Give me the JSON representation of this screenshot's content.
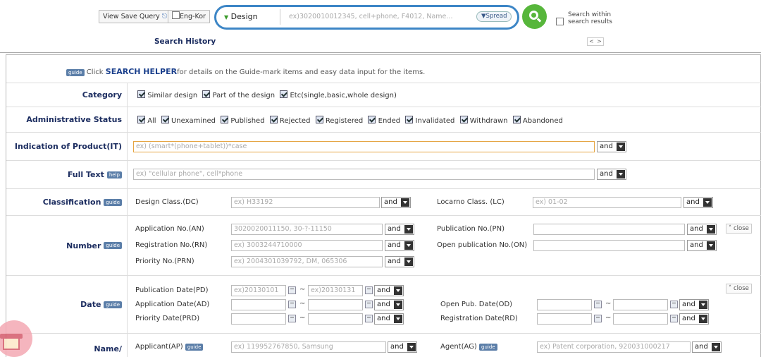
{
  "topbar": {
    "view_save_query": "View Save Query",
    "eng_kor": "Eng-Kor",
    "search_history": "Search History"
  },
  "search": {
    "category": "Design",
    "placeholder": "ex)3020010012345, cell+phone, F4012, Name...",
    "spread": "Spread",
    "within_line1": "Search within",
    "within_line2": "search results",
    "prev": "<",
    "next": ">"
  },
  "helper": {
    "guide": "guide",
    "click": "Click ",
    "helper_word": "SEARCH HELPER",
    "rest": "for details on the Guide-mark items and easy data input for the items."
  },
  "labels": {
    "category": "Category",
    "admin_status": "Administrative Status",
    "indication": "Indication of Product(IT)",
    "full_text": "Full Text",
    "help": "help",
    "classification": "Classification",
    "number": "Number",
    "date": "Date",
    "name_line1": "Name/",
    "guide": "guide"
  },
  "category_items": [
    "Similar design",
    "Part of the design",
    "Etc(single,basic,whole design)"
  ],
  "status_items": [
    "All",
    "Unexamined",
    "Published",
    "Rejected",
    "Registered",
    "Ended",
    "Invalidated",
    "Withdrawn",
    "Abandoned"
  ],
  "and": "and",
  "close": "close",
  "tilde": "~",
  "fields": {
    "indication_ph": "ex) (smart*(phone+tablet))*case",
    "fulltext_ph": "ex) \"cellular phone\", cell*phone",
    "dc": "Design Class.(DC)",
    "dc_ph": "ex) H33192",
    "lc": "Locarno Class. (LC)",
    "lc_ph": "ex) 01-02",
    "an": "Application No.(AN)",
    "an_ph": "3020020011150, 30-?-11150",
    "pn": "Publication No.(PN)",
    "rn": "Registration No.(RN)",
    "rn_ph": "ex) 3003244710000",
    "on": "Open publication No.(ON)",
    "prn": "Priority No.(PRN)",
    "prn_ph": "ex) 2004301039792, DM, 065306",
    "pd": "Publication Date(PD)",
    "pd_from": "ex)20130101",
    "pd_to": "ex)20130131",
    "ad": "Application Date(AD)",
    "prd": "Priority Date(PRD)",
    "od": "Open Pub. Date(OD)",
    "rd": "Registration Date(RD)",
    "ap": "Applicant(AP)",
    "ap_ph": "ex) 119952767850, Samsung",
    "ag": "Agent(AG)",
    "ag_ph": "ex) Patent corporation, 920031000217"
  },
  "colors": {
    "accent_blue": "#3d86c6",
    "go_green": "#57b63b",
    "label_navy": "#1c2d60",
    "focus_orange": "#e5a543"
  }
}
